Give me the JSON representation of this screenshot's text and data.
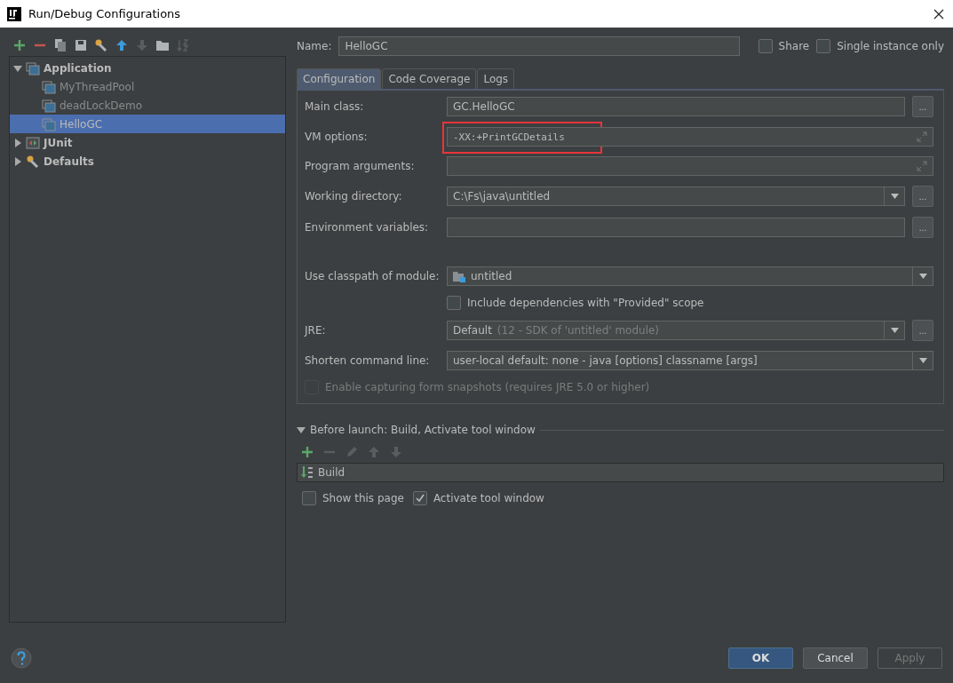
{
  "window": {
    "title": "Run/Debug Configurations"
  },
  "toolbar": [
    {
      "kind": "add",
      "disabled": false
    },
    {
      "kind": "remove",
      "disabled": false
    },
    {
      "kind": "copy",
      "disabled": false
    },
    {
      "kind": "save",
      "disabled": false
    },
    {
      "kind": "wrench",
      "disabled": false
    },
    {
      "kind": "up",
      "disabled": false
    },
    {
      "kind": "down",
      "disabled": true
    },
    {
      "kind": "folder",
      "disabled": false
    },
    {
      "kind": "sort",
      "disabled": true
    }
  ],
  "tree": [
    {
      "label": "Application",
      "kind": "application",
      "expanded": true,
      "selected": false,
      "children": [
        {
          "label": "MyThreadPool",
          "kind": "application",
          "selected": false
        },
        {
          "label": "deadLockDemo",
          "kind": "application",
          "selected": false
        },
        {
          "label": "HelloGC",
          "kind": "application",
          "selected": true
        }
      ]
    },
    {
      "label": "JUnit",
      "kind": "junit",
      "expanded": false,
      "selected": false
    },
    {
      "label": "Defaults",
      "kind": "defaults",
      "expanded": false,
      "selected": false
    }
  ],
  "name": {
    "label": "Name:",
    "value": "HelloGC"
  },
  "options": [
    {
      "label": "Share",
      "checked": false
    },
    {
      "label": "Single instance only",
      "checked": false
    }
  ],
  "tabs": [
    {
      "label": "Configuration",
      "selected": true
    },
    {
      "label": "Code Coverage",
      "selected": false
    },
    {
      "label": "Logs",
      "selected": false
    }
  ],
  "rows": [
    {
      "kind": "field",
      "label": "Main class:",
      "value": "GC.HelloGC",
      "dropdown": false,
      "expand": false,
      "browse": "...",
      "highlighted": false
    },
    {
      "kind": "field",
      "label": "VM options:",
      "value": "-XX:+PrintGCDetails",
      "mono": true,
      "dropdown": false,
      "expand": true,
      "highlighted": true
    },
    {
      "kind": "field",
      "label": "Program arguments:",
      "dropdown": false,
      "expand": true,
      "highlighted": false
    },
    {
      "kind": "field",
      "label": "Working directory:",
      "value": "C:\\Fs\\java\\untitled",
      "dropdown": true,
      "expand": false,
      "browse": "...",
      "highlighted": false
    },
    {
      "kind": "field",
      "label": "Environment variables:",
      "dropdown": false,
      "expand": false,
      "browse": "...",
      "highlighted": false
    },
    {
      "kind": "gap"
    },
    {
      "kind": "module",
      "label": "Use classpath of module:",
      "value": "untitled"
    },
    {
      "kind": "checkbox",
      "label": "Include dependencies with \"Provided\" scope",
      "checked": false,
      "disabled": false,
      "indent": true
    },
    {
      "kind": "field",
      "label": "JRE:",
      "value": "Default",
      "hint": "(12 - SDK of 'untitled' module)",
      "dropdown": true,
      "expand": false,
      "browse": "...",
      "highlighted": false
    },
    {
      "kind": "field",
      "label": "Shorten command line:",
      "value": "user-local default: none - java [options] classname [args]",
      "dropdown": true,
      "expand": false,
      "highlighted": false
    },
    {
      "kind": "checkbox",
      "label": "Enable capturing form snapshots (requires JRE 5.0 or higher)",
      "checked": false,
      "disabled": true,
      "indent": false
    }
  ],
  "before_launch": {
    "title": "Before launch: Build, Activate tool window",
    "expanded": true,
    "toolbar": [
      {
        "kind": "add",
        "disabled": false
      },
      {
        "kind": "remove",
        "disabled": true
      },
      {
        "kind": "edit",
        "disabled": true
      },
      {
        "kind": "up",
        "disabled": true
      },
      {
        "kind": "down",
        "disabled": true
      }
    ],
    "tasks": [
      {
        "label": "Build"
      }
    ],
    "options": [
      {
        "label": "Show this page",
        "checked": false
      },
      {
        "label": "Activate tool window",
        "checked": true
      }
    ]
  },
  "buttons": [
    {
      "label": "OK",
      "kind": "primary",
      "disabled": false
    },
    {
      "label": "Cancel",
      "kind": "normal",
      "disabled": false
    },
    {
      "label": "Apply",
      "kind": "normal",
      "disabled": true
    }
  ]
}
